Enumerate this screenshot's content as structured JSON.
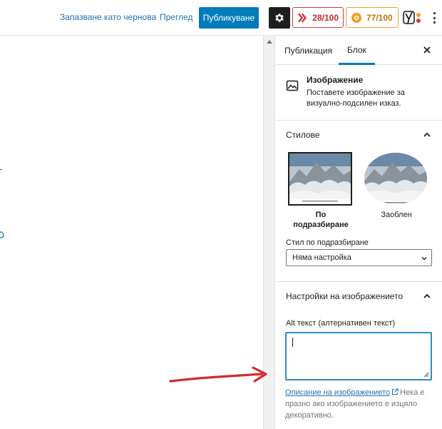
{
  "topbar": {
    "save_draft": "Запазване като чернова",
    "preview": "Преглед",
    "publish": "Публикуване",
    "seo_score": "28/100",
    "readability_score": "77/100"
  },
  "sidebar": {
    "tabs": [
      "Публикация",
      "Блок"
    ],
    "block": {
      "title": "Изображение",
      "description": "Поставете изображение за визуално-подсилен изказ."
    },
    "styles": {
      "title": "Стилове",
      "options": [
        {
          "label": "По подразбиране"
        },
        {
          "label": "Заоблен"
        }
      ],
      "default_style_label": "Стил по подразбиране",
      "default_style_value": "Няма настройка"
    },
    "image_settings": {
      "title": "Настройки на изображението",
      "alt_label": "Alt текст (алтернативен текст)",
      "alt_value": "",
      "help_link": "Описание на изображението",
      "help_text": "Нека е празно ако изображението е изцяло декоративно."
    }
  },
  "colors": {
    "accent": "#007cba",
    "seo_red": "#d63638",
    "readability_orange": "#f0a028",
    "annotation_arrow": "#d42a2a"
  }
}
